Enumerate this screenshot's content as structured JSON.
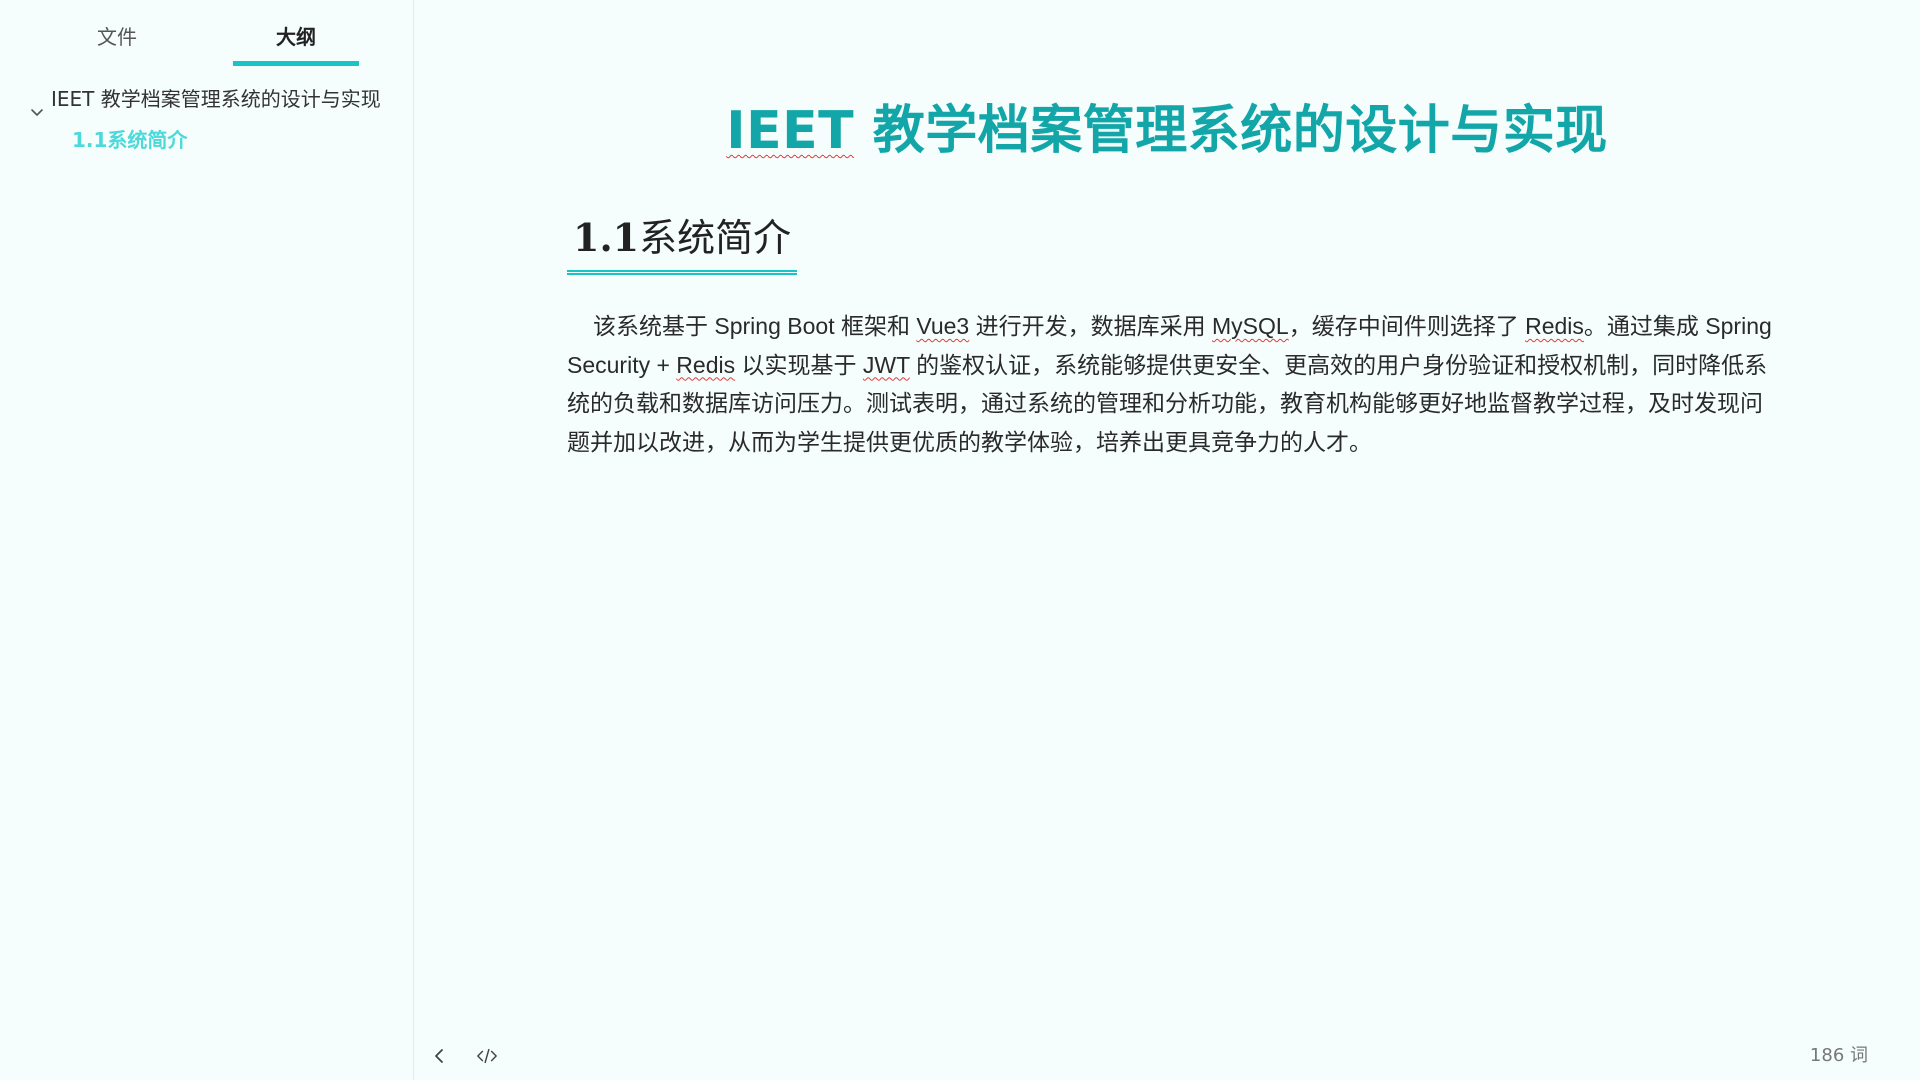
{
  "sidebar": {
    "tabs": [
      {
        "label": "文件"
      },
      {
        "label": "大纲"
      }
    ],
    "outline": {
      "root_label": "IEET 教学档案管理系统的设计与实现",
      "children": [
        {
          "label": "1.1系统简介"
        }
      ]
    }
  },
  "document": {
    "title_squiggle": "IEET",
    "title_rest": " 教学档案管理系统的设计与实现",
    "section": {
      "number": "1.1",
      "title": "系统简介"
    },
    "paragraph": {
      "p1": "该系统基于 Spring Boot 框架和 ",
      "w1": "Vue3",
      "p2": " 进行开发，数据库采用 ",
      "w2": "MySQL",
      "p3": "，缓存中间件则选择了 ",
      "w3": "Redis",
      "p4": "。通过集成 Spring Security + ",
      "w4": "Redis",
      "p5": " 以实现基于 ",
      "w5": "JWT",
      "p6": " 的鉴权认证，系统能够提供更安全、更高效的用户身份验证和授权机制，同时降低系统的负载和数据库访问压力。测试表明，通过系统的管理和分析功能，教育机构能够更好地监督教学过程，及时发现问题并加以改进，从而为学生提供更优质的教学体验，培养出更具竞争力的人才。"
    }
  },
  "footer": {
    "word_count": "186 词",
    "icons": [
      "chevron-left-icon",
      "code-icon"
    ]
  },
  "colors": {
    "accent": "#17c5c8",
    "title": "#12a6a8",
    "outline_active": "#4dd9da",
    "spellcheck": "#e03c3c",
    "background": "#f5fdfd"
  }
}
